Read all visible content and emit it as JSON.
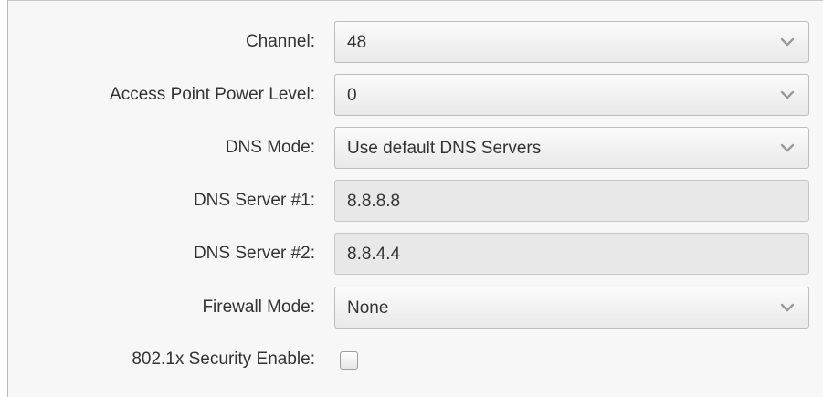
{
  "fields": {
    "channel": {
      "label": "Channel:",
      "value": "48"
    },
    "ap_power": {
      "label": "Access Point Power Level:",
      "value": "0"
    },
    "dns_mode": {
      "label": "DNS Mode:",
      "value": "Use default DNS Servers"
    },
    "dns1": {
      "label": "DNS Server #1:",
      "value": "8.8.8.8"
    },
    "dns2": {
      "label": "DNS Server #2:",
      "value": "8.8.4.4"
    },
    "firewall": {
      "label": "Firewall Mode:",
      "value": "None"
    },
    "security": {
      "label": "802.1x Security Enable:",
      "checked": false
    }
  },
  "icons": {
    "dropdown": "chevron-down-icon"
  },
  "colors": {
    "panel_bg": "#f7f7f7",
    "text": "#333333",
    "input_bg": "#e8e8e8",
    "chevron": "#9a9a9a"
  }
}
